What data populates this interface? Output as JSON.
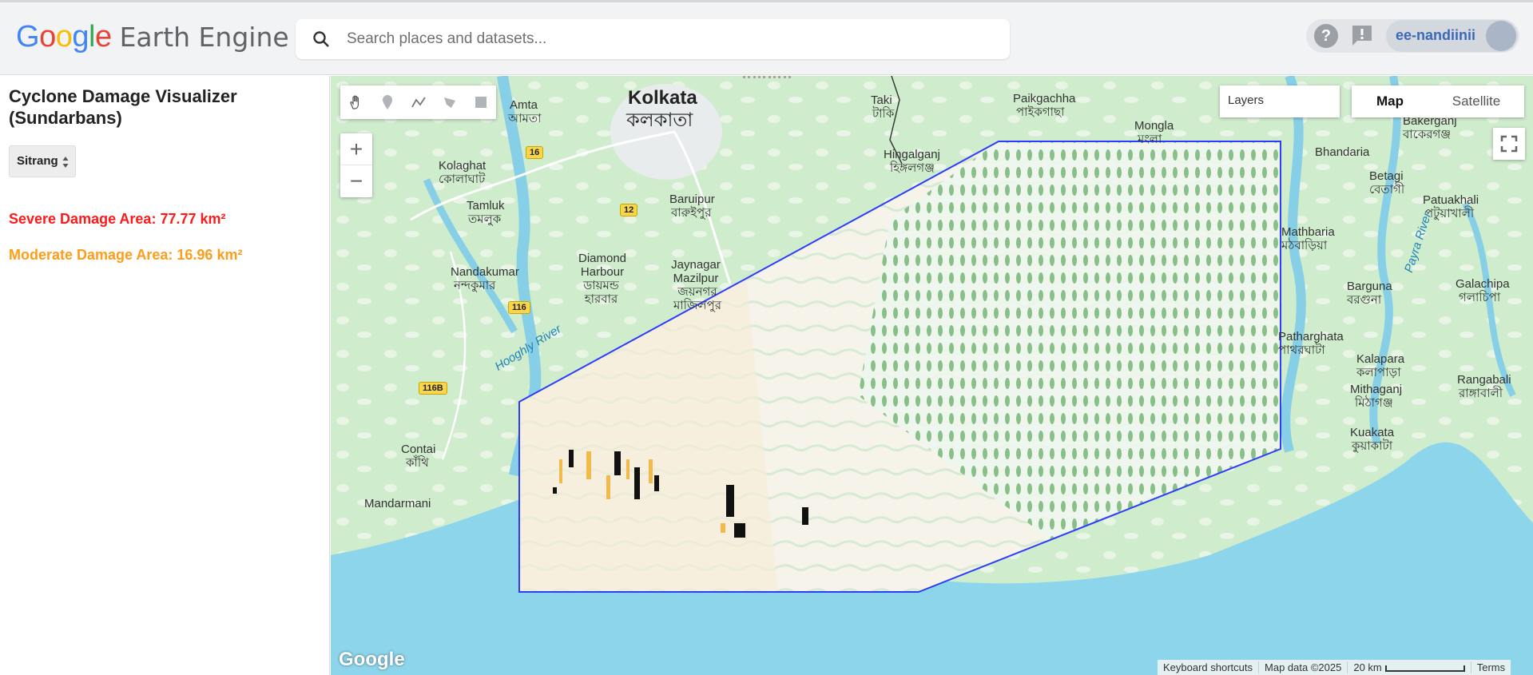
{
  "header": {
    "logo_letters": [
      {
        "ch": "G",
        "color": "#4285f4"
      },
      {
        "ch": "o",
        "color": "#ea4335"
      },
      {
        "ch": "o",
        "color": "#fbbc05"
      },
      {
        "ch": "g",
        "color": "#4285f4"
      },
      {
        "ch": "l",
        "color": "#34a853"
      },
      {
        "ch": "e",
        "color": "#ea4335"
      }
    ],
    "product_name": "Earth Engine",
    "search_placeholder": "Search places and datasets...",
    "help_icon_glyph": "?",
    "username": "ee-nandiinii"
  },
  "panel": {
    "title": "Cyclone Damage Visualizer (Sundarbans)",
    "cyclone_selected": "Sitrang",
    "severe_damage": "Severe Damage Area: 77.77 km²",
    "moderate_damage": "Moderate Damage Area: 16.96 km²",
    "severe_color": "#ff1a1a",
    "moderate_color": "#ff9c1a"
  },
  "map": {
    "controls": {
      "zoom_in": "+",
      "zoom_out": "−",
      "layers": "Layers",
      "map_type_map": "Map",
      "map_type_satellite": "Satellite"
    },
    "google_wordmark": "Google",
    "attribution": {
      "keyboard": "Keyboard shortcuts",
      "data": "Map data ©2025",
      "scale": "20 km",
      "terms": "Terms"
    },
    "labels": {
      "kolkata": "Kolkata",
      "kolkata_bn": "কলকাতা",
      "amta": "Amta",
      "amta_bn": "আমতা",
      "kolaghat": "Kolaghat",
      "kolaghat_bn": "কোলাঘাট",
      "baruipur": "Baruipur",
      "baruipur_bn": "বারুইপুর",
      "tamluk": "Tamluk",
      "tamluk_bn": "তমলুক",
      "diamond_harbour": "Diamond Harbour",
      "diamond_harbour_bn": "ডায়মন্ড হারবার",
      "jaynagar": "Jaynagar Mazilpur",
      "jaynagar_bn": "জয়নগর মাজিলপুর",
      "nandakumar": "Nandakumar",
      "nandakumar_bn": "নন্দকুমার",
      "contai": "Contai",
      "contai_bn": "কাঁথি",
      "mandarmani": "Mandarmani",
      "taki": "Taki",
      "taki_bn": "টাকি",
      "hingalganj": "Hingalganj",
      "hingalganj_bn": "হিঙ্গলগঞ্জ",
      "paikgachha": "Paikgachha",
      "paikgachha_bn": "পাইকগাছা",
      "mongla": "Mongla",
      "mongla_bn": "মংলা",
      "bhandaria": "Bhandaria",
      "bakerganj": "Bakerganj",
      "bakerganj_bn": "বাকেরগঞ্জ",
      "betagi": "Betagi",
      "betagi_bn": "বেতাগী",
      "patuakhali": "Patuakhali",
      "patuakhali_bn": "পটুয়াখালী",
      "mathbaria": "Mathbaria",
      "mathbaria_bn": "মঠবাড়িয়া",
      "barguna": "Barguna",
      "barguna_bn": "বরগুনা",
      "galachipa": "Galachipa",
      "galachipa_bn": "গলাচিপা",
      "patharghata": "Patharghata",
      "patharghata_bn": "পাথরঘাটা",
      "kalapara": "Kalapara",
      "kalapara_bn": "কলাপাড়া",
      "mithaganj": "Mithaganj",
      "mithaganj_bn": "মিঠাগঞ্জ",
      "rangabali": "Rangabali",
      "rangabali_bn": "রাঙ্গাবালী",
      "kuakata": "Kuakata",
      "kuakata_bn": "কুয়াকাটা",
      "hooghly_river": "Hooghly River",
      "payra_river": "Payra River",
      "road_16": "16",
      "road_12": "12",
      "road_116": "116",
      "road_116b": "116B"
    }
  }
}
